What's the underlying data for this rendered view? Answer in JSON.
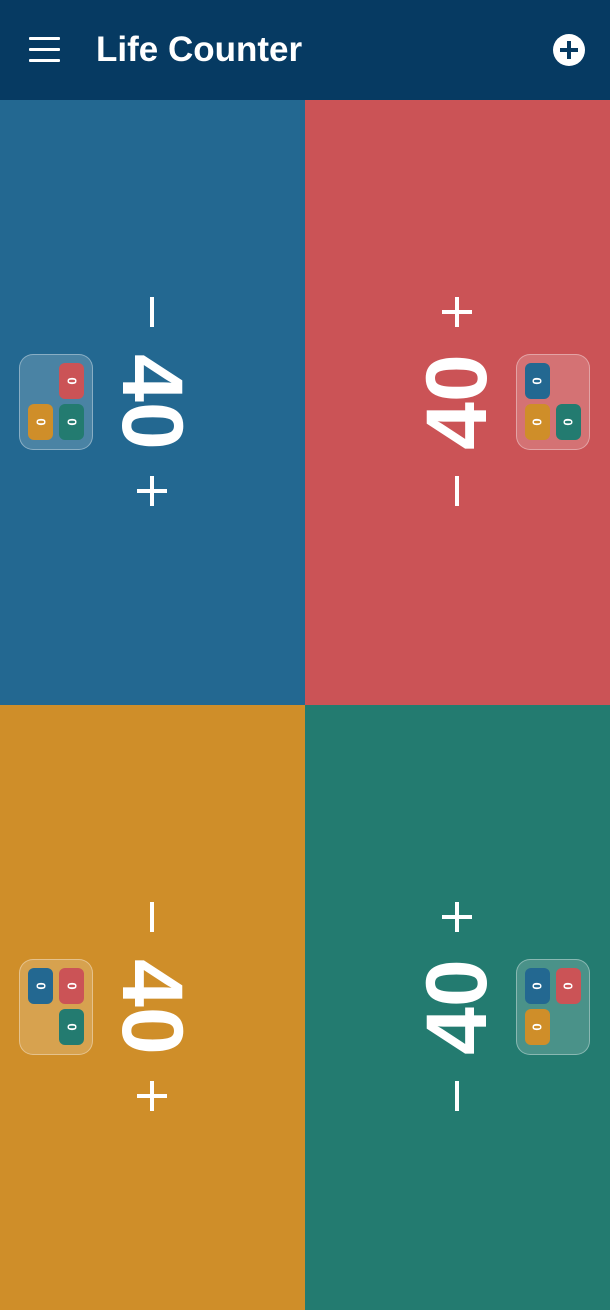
{
  "app": {
    "title": "Life Counter",
    "menu_icon": "hamburger-menu-icon",
    "add_icon": "add-circle-icon"
  },
  "colors": {
    "appbar": "#063a62",
    "blue": "#236891",
    "red": "#cb5356",
    "yellow": "#cf8e29",
    "teal": "#237b70"
  },
  "players": [
    {
      "id": "p1",
      "color": "#236891",
      "life": "40",
      "commander_damage": {
        "from_red": "0",
        "from_yellow": "0",
        "from_teal": "0"
      }
    },
    {
      "id": "p2",
      "color": "#cb5356",
      "life": "40",
      "commander_damage": {
        "from_blue": "0",
        "from_yellow": "0",
        "from_teal": "0"
      }
    },
    {
      "id": "p3",
      "color": "#cf8e29",
      "life": "40",
      "commander_damage": {
        "from_blue": "0",
        "from_red": "0",
        "from_teal": "0"
      }
    },
    {
      "id": "p4",
      "color": "#237b70",
      "life": "40",
      "commander_damage": {
        "from_blue": "0",
        "from_red": "0",
        "from_yellow": "0"
      }
    }
  ]
}
